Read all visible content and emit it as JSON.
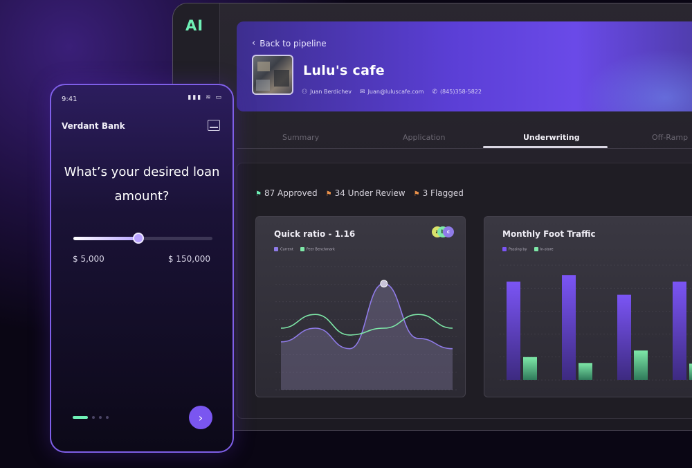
{
  "desktop": {
    "logo": "AI",
    "header": {
      "back_label": "Back to pipeline",
      "business_name": "Lulu's cafe",
      "contact_name": "Juan Berdichev",
      "contact_email": "Juan@luluscafe.com",
      "contact_phone": "(845)358-5822"
    },
    "tabs": [
      {
        "label": "Summary",
        "active": false
      },
      {
        "label": "Application",
        "active": false
      },
      {
        "label": "Underwriting",
        "active": true
      },
      {
        "label": "Off-Ramp",
        "active": false
      }
    ],
    "stats": {
      "approved": "87 Approved",
      "under_review": "34 Under Review",
      "flagged": "3 Flagged"
    },
    "colors": {
      "approved": "#6ff0b6",
      "under_review": "#e8904a",
      "flagged": "#e8904a"
    }
  },
  "quick_ratio_card": {
    "title": "Quick ratio - 1.16",
    "legend": [
      "Current",
      "Peer Benchmark"
    ],
    "pills": [
      "a",
      "b",
      "c"
    ]
  },
  "foot_traffic_card": {
    "title": "Monthly Foot Traffic",
    "legend": [
      "Passing by",
      "In-store"
    ]
  },
  "chart_data": [
    {
      "type": "line",
      "title": "Quick ratio - 1.16",
      "series": [
        {
          "name": "Current",
          "color": "#8f7be8",
          "values": [
            1.1,
            1.3,
            1.0,
            1.95,
            1.15,
            1.0
          ]
        },
        {
          "name": "Peer Benchmark",
          "color": "#7ee8a8",
          "values": [
            1.3,
            1.5,
            1.2,
            1.3,
            1.5,
            1.3
          ]
        }
      ]
    },
    {
      "type": "bar",
      "title": "Monthly Foot Traffic",
      "series": [
        {
          "name": "Passing by",
          "color": "#7b55f5",
          "values": [
            3000,
            3200,
            2600,
            3000
          ]
        },
        {
          "name": "In-store",
          "color": "#7ee8a8",
          "values": [
            700,
            520,
            900,
            500
          ]
        }
      ]
    }
  ],
  "phone": {
    "time": "9:41",
    "status": "▮▮▮ ≋ ▭",
    "bank_name": "Verdant Bank",
    "question": "What’s your desired loan amount?",
    "slider_fraction": 0.47,
    "range_min": "$ 5,000",
    "range_max": "$ 150,000",
    "next_icon": "›"
  }
}
